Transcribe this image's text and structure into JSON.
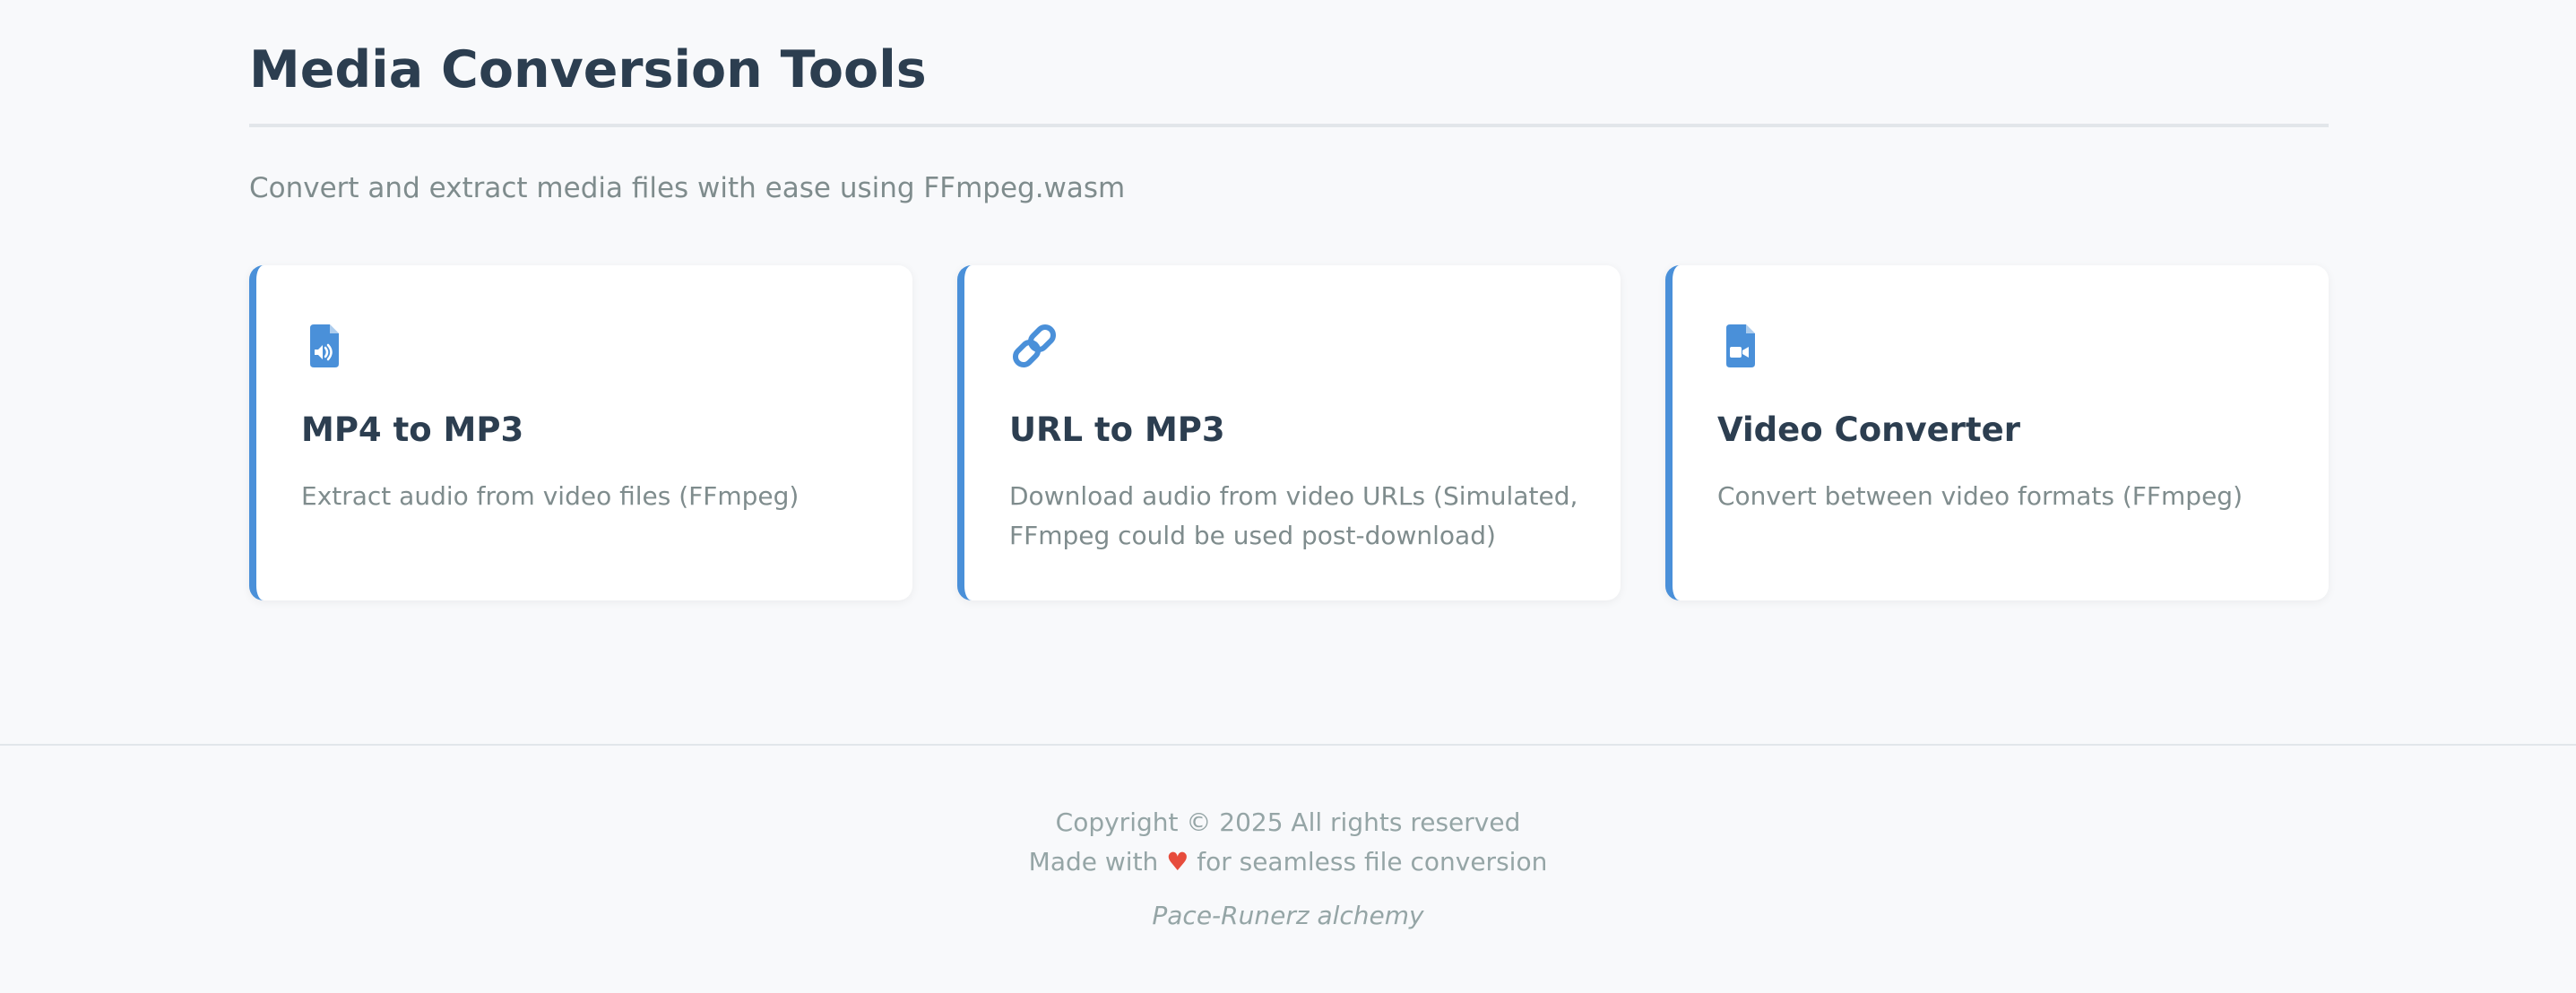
{
  "header": {
    "title": "Media Conversion Tools",
    "subtitle": "Convert and extract media files with ease using FFmpeg.wasm"
  },
  "cards": [
    {
      "icon": "file-audio-icon",
      "title": "MP4 to MP3",
      "description": "Extract audio from video files (FFmpeg)"
    },
    {
      "icon": "link-icon",
      "title": "URL to MP3",
      "description": "Download audio from video URLs (Simulated, FFmpeg could be used post-download)"
    },
    {
      "icon": "file-video-icon",
      "title": "Video Converter",
      "description": "Convert between video formats (FFmpeg)"
    }
  ],
  "footer": {
    "copyright": "Copyright © 2025 All rights reserved",
    "made_with_prefix": "Made with",
    "heart": "♥",
    "made_with_suffix": "for seamless file conversion",
    "tagline": "Pace-Runerz alchemy"
  },
  "colors": {
    "accent": "#4a90d9",
    "heading": "#2c3e50",
    "muted": "#7f8c8d",
    "heart": "#e74c3c",
    "background": "#f8f9fb"
  }
}
